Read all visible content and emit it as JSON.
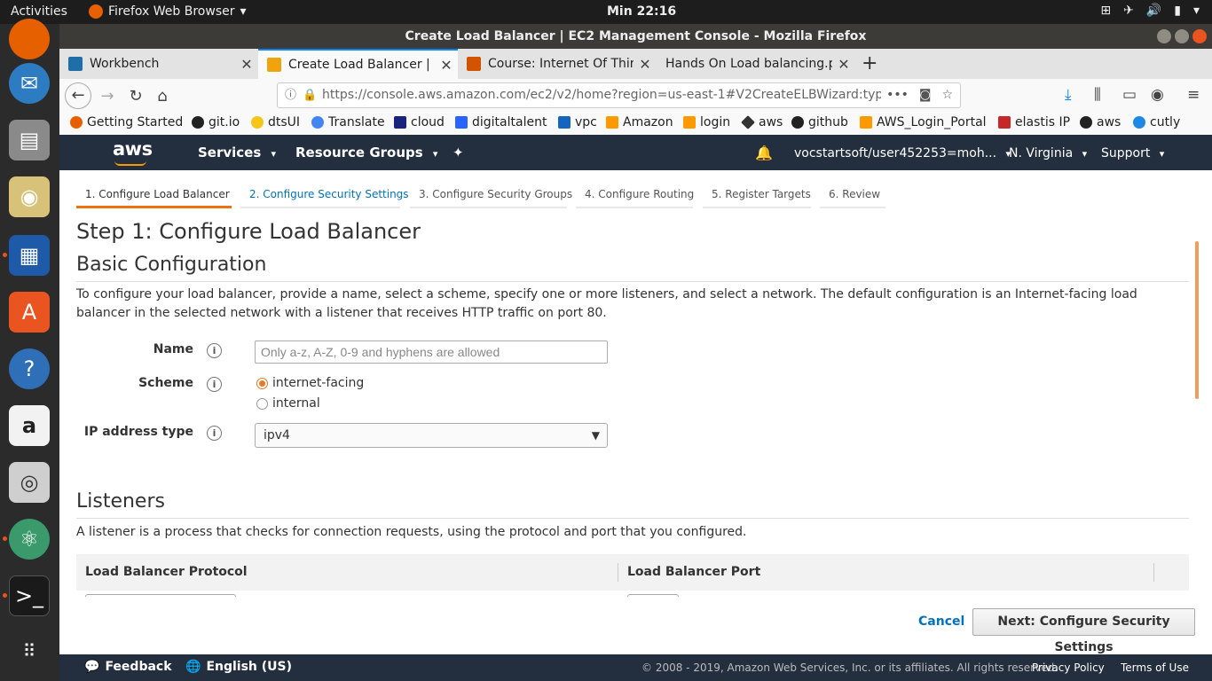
{
  "system": {
    "activities": "Activities",
    "app_menu": "Firefox Web Browser",
    "clock": "Min 22:16"
  },
  "window": {
    "title": "Create Load Balancer | EC2 Management Console - Mozilla Firefox"
  },
  "tabs": [
    {
      "label": "Workbench",
      "icon_color": "#1e6fa8"
    },
    {
      "label": "Create Load Balancer | Ec",
      "icon_color": "#f0a30a"
    },
    {
      "label": "Course: Internet Of Thing",
      "icon_color": "#d35400"
    },
    {
      "label": "Hands On Load balancing.pd",
      "icon_color": "#f9f9f9"
    }
  ],
  "urlbar": {
    "url": "https://console.aws.amazon.com/ec2/v2/home?region=us-east-1#V2CreateELBWizard:typ"
  },
  "bookmarks": [
    {
      "label": "Getting Started",
      "color": "#e66000"
    },
    {
      "label": "git.io",
      "color": "#222222"
    },
    {
      "label": "dtsUI",
      "color": "#f5c518"
    },
    {
      "label": "Translate",
      "color": "#4285f4"
    },
    {
      "label": "cloud",
      "color": "#1a237e"
    },
    {
      "label": "digitaltalent",
      "color": "#2962ff"
    },
    {
      "label": "vpc",
      "color": "#1565c0"
    },
    {
      "label": "Amazon",
      "color": "#ff9900"
    },
    {
      "label": "login",
      "color": "#ff9900"
    },
    {
      "label": "aws",
      "color": "#333333"
    },
    {
      "label": "github",
      "color": "#222222"
    },
    {
      "label": "AWS_Login_Portal",
      "color": "#ff9900"
    },
    {
      "label": "elastis IP",
      "color": "#c62828"
    },
    {
      "label": "aws",
      "color": "#222222"
    },
    {
      "label": "cutly",
      "color": "#1e88e5"
    }
  ],
  "aws_nav": {
    "logo": "aws",
    "services": "Services",
    "resource_groups": "Resource Groups",
    "account": "vocstartsoft/user452253=moh...",
    "region": "N. Virginia",
    "support": "Support"
  },
  "wizard_steps": [
    "1. Configure Load Balancer",
    "2. Configure Security Settings",
    "3. Configure Security Groups",
    "4. Configure Routing",
    "5. Register Targets",
    "6. Review"
  ],
  "page": {
    "title": "Step 1: Configure Load Balancer",
    "basic_config": {
      "heading": "Basic Configuration",
      "description": "To configure your load balancer, provide a name, select a scheme, specify one or more listeners, and select a network. The default configuration is an Internet-facing load balancer in the selected network with a listener that receives HTTP traffic on port 80.",
      "name_label": "Name",
      "name_placeholder": "Only a-z, A-Z, 0-9 and hyphens are allowed",
      "scheme_label": "Scheme",
      "scheme_options": [
        "internet-facing",
        "internal"
      ],
      "scheme_selected": "internet-facing",
      "ip_label": "IP address type",
      "ip_value": "ipv4"
    },
    "listeners": {
      "heading": "Listeners",
      "description": "A listener is a process that checks for connection requests, using the protocol and port that you configured.",
      "columns": [
        "Load Balancer Protocol",
        "Load Balancer Port"
      ]
    }
  },
  "actions": {
    "cancel": "Cancel",
    "next": "Next: Configure Security Settings"
  },
  "footer": {
    "feedback": "Feedback",
    "language": "English (US)",
    "copyright": "© 2008 - 2019, Amazon Web Services, Inc. or its affiliates. All rights reserved.",
    "privacy": "Privacy Policy",
    "terms": "Terms of Use"
  },
  "colors": {
    "aws_navy": "#232f3e",
    "aws_orange": "#ec7211",
    "link_blue": "#0073bb"
  }
}
